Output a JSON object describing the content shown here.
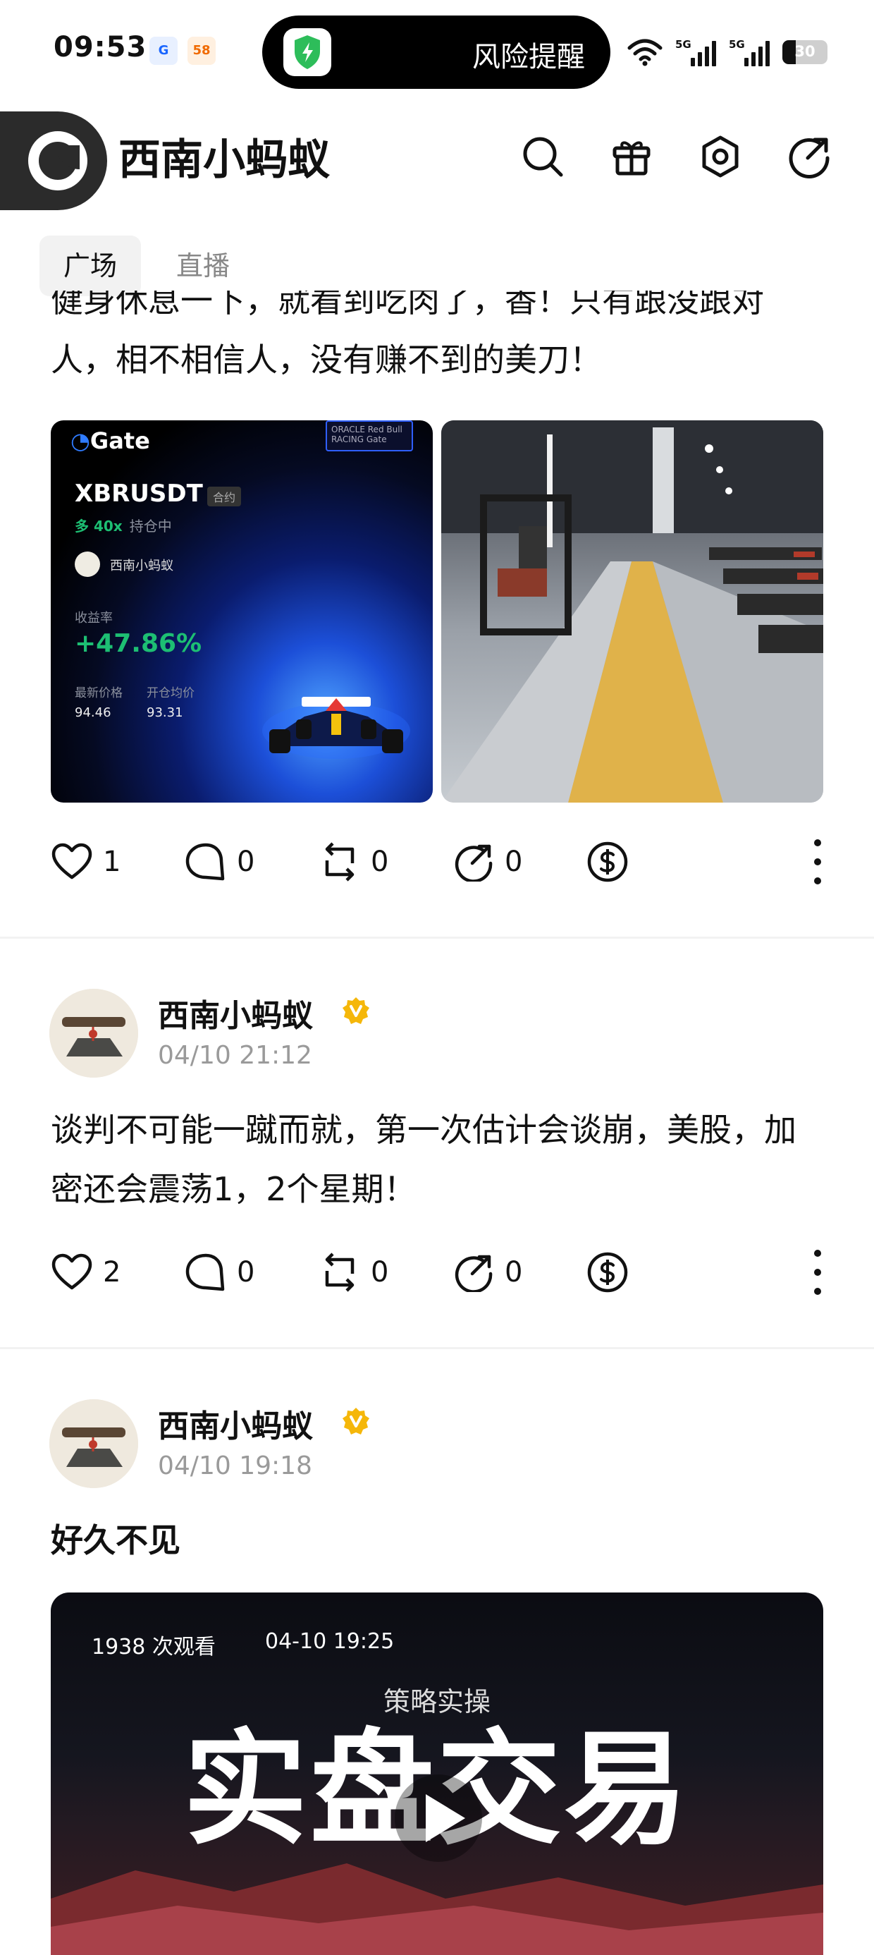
{
  "status_bar": {
    "time": "09:53",
    "app_icons": [
      "G",
      "58"
    ],
    "alert_text": "风险提醒",
    "signal_labels": [
      "5G",
      "5G"
    ],
    "battery_level": "30",
    "battery_fraction": 0.3
  },
  "header": {
    "title": "西南小蚂蚁",
    "icons": [
      "search-icon",
      "gift-icon",
      "settings-icon",
      "share-icon"
    ]
  },
  "tabs": [
    {
      "label": "广场",
      "active": true
    },
    {
      "label": "直播",
      "active": false
    }
  ],
  "posts": [
    {
      "text": "健身休息一下，就看到吃肉了，香！只有跟没跟对人，相不相信人，没有赚不到的美刀！",
      "trade_card": {
        "brand": "Gate",
        "partner_text": "ORACLE Red Bull RACING",
        "partner_brand": "Gate",
        "symbol": "XBRUSDT",
        "symbol_tag": "合约",
        "leverage": "多 40x",
        "position_label": "持仓中",
        "user": "西南小蚂蚁",
        "return_label": "收益率",
        "return_value": "+47.86%",
        "latest_price_label": "最新价格",
        "latest_price": "94.46",
        "entry_price_label": "开仓均价",
        "entry_price": "93.31"
      },
      "stats": {
        "likes": "1",
        "comments": "0",
        "reposts": "0",
        "shares": "0"
      }
    },
    {
      "author": "西南小蚂蚁",
      "time": "04/10 21:12",
      "text": "谈判不可能一蹴而就，第一次估计会谈崩，美股，加密还会震荡1，2个星期！",
      "stats": {
        "likes": "2",
        "comments": "0",
        "reposts": "0",
        "shares": "0"
      }
    },
    {
      "author": "西南小蚂蚁",
      "time": "04/10 19:18",
      "text": "好久不见",
      "video": {
        "views": "1938 次观看",
        "date": "04-10 19:25",
        "subtitle": "策略实操",
        "title": "实盘交易"
      }
    }
  ],
  "colors": {
    "accent_green": "#1dbf73",
    "verified_gold": "#f5b70a",
    "muted_text": "#9a9a9a"
  }
}
